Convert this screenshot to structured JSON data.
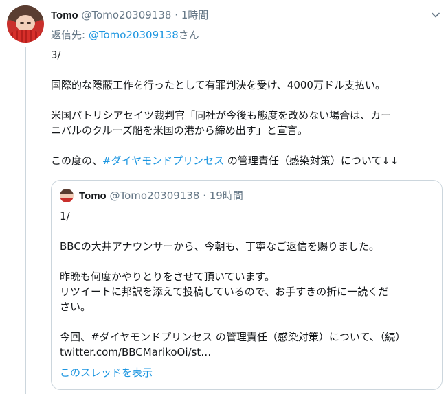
{
  "tweet": {
    "name": "Tomo",
    "handle": "@Tomo20309138",
    "dot": " · ",
    "time": "1時間",
    "reply_prefix": "返信先: ",
    "reply_handle": "@Tomo20309138",
    "reply_suffix": "さん",
    "lines": {
      "l1": "3/",
      "l2": "国際的な隠蔽工作を行ったとして有罪判決を受け、4000万ドル支払い。",
      "l3": "米国パトリシアセイツ裁判官「同社が今後も態度を改めない場合は、カー",
      "l4": "ニバルのクルーズ船を米国の港から締め出す」と宣言。",
      "l5_pre": "この度の、",
      "l5_hash": "#ダイヤモンドプリンセス",
      "l5_post": " の管理責任（感染対策）について↓↓"
    }
  },
  "quote": {
    "name": "Tomo",
    "handle": "@Tomo20309138",
    "dot": " · ",
    "time": "19時間",
    "lines": {
      "q1": "1/",
      "q2": "BBCの大井アナウンサーから、今朝も、丁寧なご返信を賜りました。",
      "q3": "昨晩も何度かやりとりをさせて頂いています。",
      "q4": "リツイートに邦訳を添えて投稿しているので、お手すきの折に一読くだ",
      "q5": "さい。",
      "q6": "今回、#ダイヤモンドプリンセス の管理責任（感染対策）について、（続）",
      "q7": "twitter.com/BBCMarikoOi/st…"
    },
    "show_thread": "このスレッドを表示"
  },
  "icons": {
    "menu": "chevron-down-icon",
    "avatar": "avatar-icon"
  },
  "colors": {
    "link": "#1b95e0",
    "secondary": "#657786",
    "border": "#ccd6dd"
  }
}
